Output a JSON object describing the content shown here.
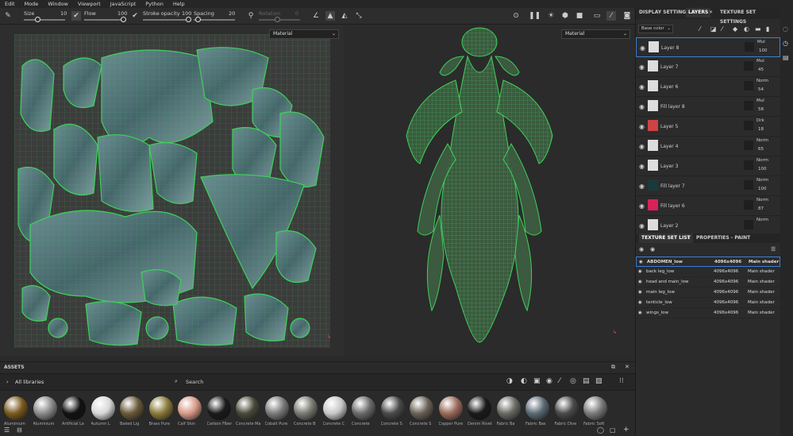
{
  "menu": [
    "Edit",
    "Mode",
    "Window",
    "Viewport",
    "JavaScript",
    "Python",
    "Help"
  ],
  "toolbar": {
    "size_label": "Size",
    "size_value": "10",
    "flow_label": "Flow",
    "flow_value": "100",
    "stroke_label": "Stroke opacity",
    "stroke_value": "100",
    "spacing_label": "Spacing",
    "spacing_value": "20",
    "rotation_label": "Rotation",
    "rotation_value": "0"
  },
  "viewport2d": {
    "material": "Material"
  },
  "viewport3d": {
    "material": "Material"
  },
  "assets": {
    "title": "ASSETS",
    "library": "All libraries",
    "search_placeholder": "Search",
    "items": [
      "Aluminium",
      "Aluminium",
      "Artificial Le",
      "Autumn L",
      "Baked Lig",
      "Brass Pure",
      "Calf Skin",
      "Carbon Fiber",
      "Concrete Ma",
      "Cobalt Pure",
      "Concrete B",
      "Concrete C",
      "Concrete",
      "Concrete S",
      "Concrete S",
      "Copper Pure",
      "Denim Rivet",
      "Fabric Ba",
      "Fabric Bas",
      "Fabric Dive",
      "Fabric Soft"
    ]
  },
  "panel_tabs": {
    "display": "DISPLAY SETTINGS",
    "layers": "LAYERS",
    "texture": "TEXTURE SET SETTINGS"
  },
  "channel": "Base color",
  "layers": [
    {
      "name": "Layer 8",
      "blend": "Mul",
      "opacity": "100"
    },
    {
      "name": "Layer 7",
      "blend": "Mul",
      "opacity": "45"
    },
    {
      "name": "Layer 6",
      "blend": "Norm",
      "opacity": "54"
    },
    {
      "name": "Fill layer 8",
      "blend": "Mul",
      "opacity": "58"
    },
    {
      "name": "Layer 5",
      "blend": "Drk",
      "opacity": "18"
    },
    {
      "name": "Layer 4",
      "blend": "Norm",
      "opacity": "65"
    },
    {
      "name": "Layer 3",
      "blend": "Norm",
      "opacity": "100"
    },
    {
      "name": "Fill layer 7",
      "blend": "Norm",
      "opacity": "100"
    },
    {
      "name": "Fill layer 6",
      "blend": "Norm",
      "opacity": "87"
    },
    {
      "name": "Layer 2",
      "blend": "Norm",
      "opacity": ""
    }
  ],
  "texset_tabs": {
    "list": "TEXTURE SET LIST",
    "props": "PROPERTIES - PAINT"
  },
  "texture_sets": [
    {
      "name": "ABDOMEN_low",
      "res": "4096x4096",
      "shader": "Main shader"
    },
    {
      "name": "back leg_low",
      "res": "4096x4096",
      "shader": "Main shader"
    },
    {
      "name": "head and main_low",
      "res": "4096x4096",
      "shader": "Main shader"
    },
    {
      "name": "main leg_low",
      "res": "4096x4096",
      "shader": "Main shader"
    },
    {
      "name": "tenticle_low",
      "res": "4096x4096",
      "shader": "Main shader"
    },
    {
      "name": "wings_low",
      "res": "4096x4096",
      "shader": "Main shader"
    }
  ],
  "colors": {
    "accent": "#3d7fd6",
    "mesh": "#3ed15a",
    "texture": "#5f8086"
  }
}
